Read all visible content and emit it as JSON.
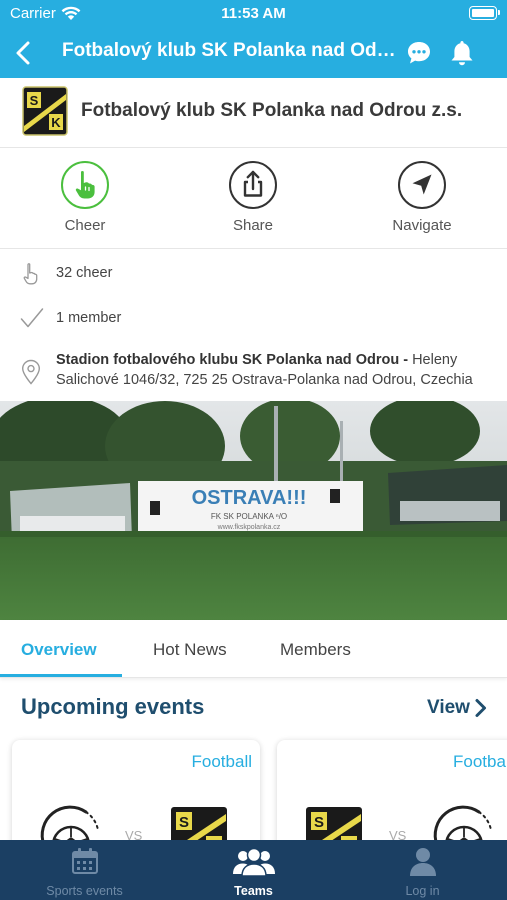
{
  "status_bar": {
    "carrier": "Carrier",
    "time": "11:53 AM"
  },
  "nav": {
    "title": "Fotbalový klub SK Polanka nad Odrou z.s."
  },
  "club": {
    "name": "Fotbalový klub SK Polanka nad Odrou z.s.",
    "logo_letters": [
      "S",
      "K"
    ],
    "logo_text": "POLANKA ⁿ/O"
  },
  "actions": [
    {
      "label": "Cheer",
      "icon": "cheer-hand-icon"
    },
    {
      "label": "Share",
      "icon": "share-icon"
    },
    {
      "label": "Navigate",
      "icon": "navigate-arrow-icon"
    }
  ],
  "info": {
    "cheer_count": "32 cheer",
    "members": "1 member",
    "venue_name": "Stadion fotbalového klubu SK Polanka nad Odrou - ",
    "venue_address": "Heleny Salichové 1046/32, 725 25 Ostrava-Polanka nad Odrou, Czechia"
  },
  "photo": {
    "banner_main": "OSTRAVA!!!",
    "banner_sub": "FK SK POLANKA ⁿ/O",
    "banner_url": "www.fkskpolanka.cz"
  },
  "tabs": [
    {
      "label": "Overview",
      "active": true
    },
    {
      "label": "Hot News",
      "active": false
    },
    {
      "label": "Members",
      "active": false
    }
  ],
  "upcoming": {
    "title": "Upcoming events",
    "view_label": "View",
    "cards": [
      {
        "sport": "Football",
        "vs": "VS"
      },
      {
        "sport": "Football",
        "vs": "VS"
      }
    ]
  },
  "tab_bar": [
    {
      "label": "Sports events",
      "icon": "calendar-icon",
      "active": false
    },
    {
      "label": "Teams",
      "icon": "teams-icon",
      "active": true
    },
    {
      "label": "Log in",
      "icon": "user-icon",
      "active": false
    }
  ],
  "colors": {
    "accent": "#27aee0",
    "navy": "#1b3f63",
    "cheer_green": "#4bbf3e",
    "title_navy": "#1f4e6e"
  }
}
